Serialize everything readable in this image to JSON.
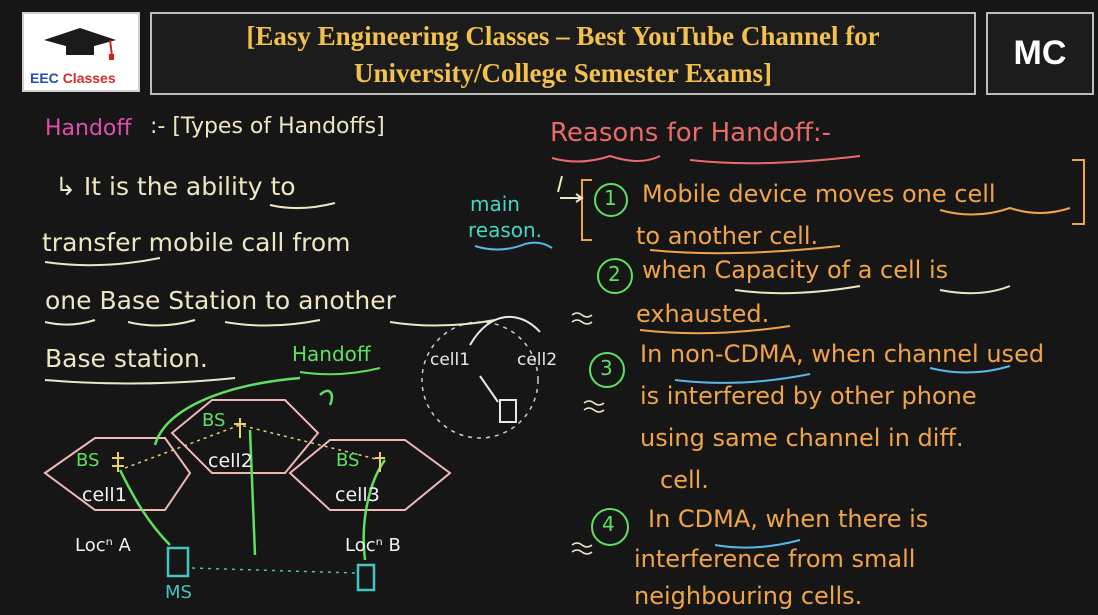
{
  "header": {
    "logo_label_part1": "EEC",
    "logo_label_part2": "Classes",
    "title_line1": "[Easy Engineering Classes – Best YouTube Channel for",
    "title_line2": "University/College Semester Exams]",
    "badge": "MC"
  },
  "left": {
    "handoff_word": "Handoff",
    "types_note": ":- [Types of Handoffs]",
    "def_line1": "↳ It is the ability to",
    "def_line2": "transfer mobile call from",
    "def_line3": "one Base Station to another",
    "def_line4": "Base station.",
    "main_reason_1": "main",
    "main_reason_2": "reason.",
    "handoff_label": "Handoff"
  },
  "diagram": {
    "cell1": "cell1",
    "cell2": "cell2",
    "cell3": "cell3",
    "bs1": "BS",
    "bs2": "BS",
    "bs3": "BS",
    "loc_a": "Locⁿ A",
    "loc_b": "Locⁿ B",
    "ms": "MS",
    "small_cell1": "cell1",
    "small_cell2": "cell2"
  },
  "right": {
    "heading": "Reasons for Handoff:-",
    "r1_num": "1",
    "r1_line1": "Mobile device moves one cell",
    "r1_line2": "to another cell.",
    "r2_num": "2",
    "r2_line1": "when Capacity of a cell is",
    "r2_line2": "exhausted.",
    "r3_num": "3",
    "r3_line1": "In non-CDMA, when channel used",
    "r3_line2": "is interfered by other phone",
    "r3_line3": "using same channel in diff.",
    "r3_line4": "cell.",
    "r4_num": "4",
    "r4_line1": "In CDMA, when there is",
    "r4_line2": "interference from small",
    "r4_line3": "neighbouring cells."
  },
  "colors": {
    "board": "#161616",
    "title_text": "#f2c14e",
    "cream_text": "#ece6c2",
    "orange_text": "#f0a44a",
    "green_text": "#5fe05f",
    "heading_red": "#ea6a6a",
    "handoff_magenta": "#e04fb0",
    "hexagon": "#f1b6b6",
    "underline_blue": "#58b9e8"
  }
}
